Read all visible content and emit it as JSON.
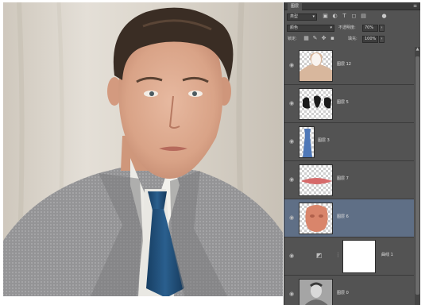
{
  "panel": {
    "tab_label": "图层",
    "menu_icon": "panel-menu-icon",
    "filter": {
      "kind_label": "类型",
      "icons": [
        "image-filter-icon",
        "adjust-filter-icon",
        "type-filter-icon",
        "shape-filter-icon",
        "smart-filter-icon",
        "filter-toggle-icon"
      ]
    },
    "blend_mode": "颜色",
    "opacity_label": "不透明度:",
    "opacity_value": "70%",
    "lock_label": "锁定:",
    "fill_label": "填充:",
    "fill_value": "100%"
  },
  "layers": [
    {
      "name": "图层 12",
      "visible": true,
      "selected": false,
      "thumb": "skin-silhouette"
    },
    {
      "name": "图层 5",
      "visible": true,
      "selected": false,
      "thumb": "hair-strokes"
    },
    {
      "name": "图层 3",
      "visible": true,
      "selected": false,
      "thumb": "blue-tie"
    },
    {
      "name": "图层 7",
      "visible": true,
      "selected": false,
      "thumb": "red-lips"
    },
    {
      "name": "图层 6",
      "visible": true,
      "selected": true,
      "thumb": "face-color"
    },
    {
      "name": "曲线 1",
      "visible": true,
      "selected": false,
      "thumb": "curves-adjustment"
    },
    {
      "name": "图层 0",
      "visible": true,
      "selected": false,
      "thumb": "bw-portrait"
    }
  ],
  "colors": {
    "panel_bg": "#535353",
    "selected_row": "#5f6f86",
    "tie": "#1f4e7a",
    "suit": "#8d8d8f"
  }
}
